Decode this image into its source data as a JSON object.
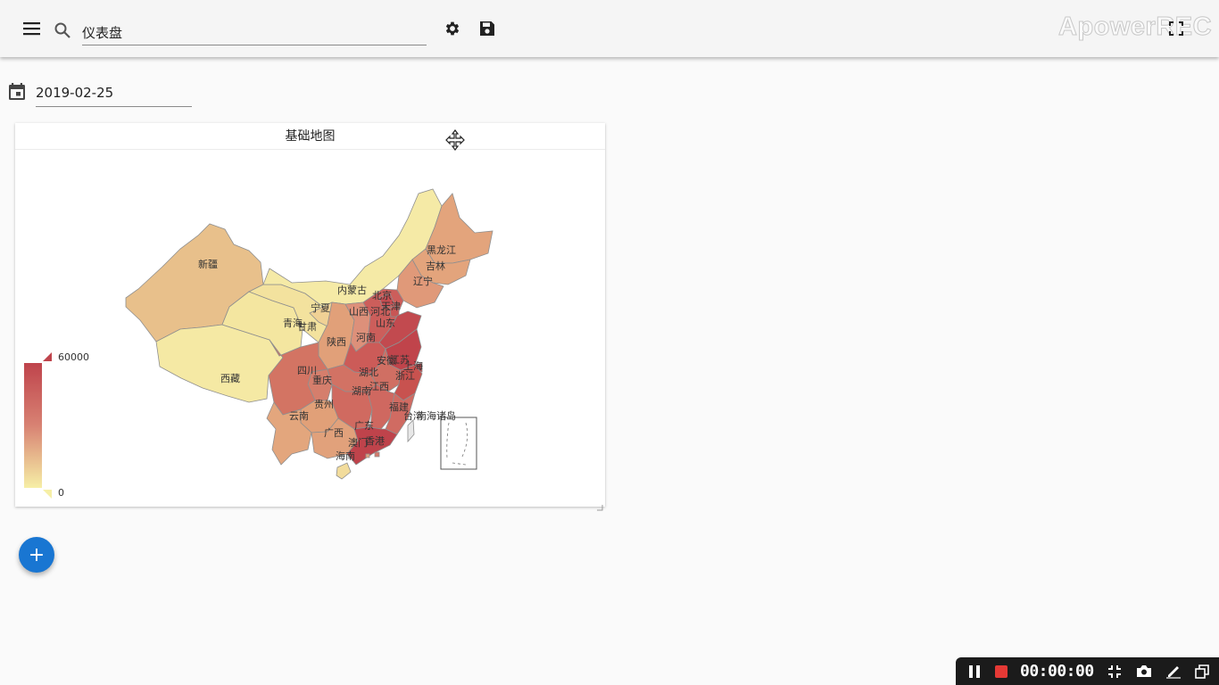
{
  "toolbar": {
    "menu_icon": "menu-icon",
    "search_icon": "search-icon",
    "search_value": "仪表盘",
    "settings_icon": "gear-icon",
    "save_icon": "save-icon",
    "fullscreen_icon": "fullscreen-icon"
  },
  "watermark": "ApowerREC",
  "date_field": {
    "icon": "calendar-icon",
    "value": "2019-02-25"
  },
  "map_card": {
    "title": "基础地图",
    "visual_map": {
      "max_label": "60000",
      "min_label": "0",
      "colors": [
        "#f6efa6",
        "#d88273",
        "#bf444c"
      ]
    },
    "region_labels": [
      "新疆",
      "西藏",
      "青海",
      "甘肃",
      "宁夏",
      "内蒙古",
      "黑龙江",
      "吉林",
      "辽宁",
      "北京",
      "天津",
      "河北",
      "山西",
      "山东",
      "陕西",
      "河南",
      "四川",
      "重庆",
      "湖北",
      "安徽",
      "江苏",
      "上海",
      "浙江",
      "湖南",
      "江西",
      "贵州",
      "云南",
      "福建",
      "广西",
      "广东",
      "香港",
      "澳门",
      "海南",
      "台湾",
      "南海诸岛"
    ]
  },
  "fab": {
    "label": "+"
  },
  "recorder": {
    "time": "00:00:00",
    "pause_icon": "pause-icon",
    "stop_icon": "stop-icon",
    "shrink_icon": "shrink-icon",
    "camera_icon": "camera-icon",
    "pen_icon": "pen-icon",
    "window_icon": "window-icon"
  }
}
